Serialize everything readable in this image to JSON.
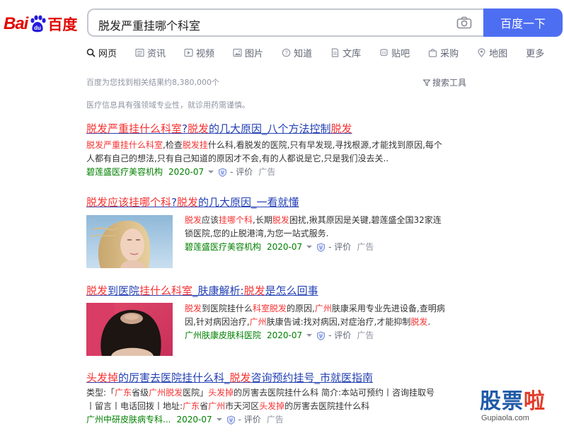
{
  "logo": {
    "left": "Bai",
    "right": "百度"
  },
  "search": {
    "query": "脱发严重挂哪个科室",
    "button": "百度一下"
  },
  "tabs": [
    {
      "label": "网页",
      "icon": "search-icon",
      "active": true
    },
    {
      "label": "资讯",
      "icon": "news-icon"
    },
    {
      "label": "视频",
      "icon": "video-icon"
    },
    {
      "label": "图片",
      "icon": "image-icon"
    },
    {
      "label": "知道",
      "icon": "question-icon"
    },
    {
      "label": "文库",
      "icon": "document-icon"
    },
    {
      "label": "贴吧",
      "icon": "tieba-icon"
    },
    {
      "label": "采购",
      "icon": "purchase-icon"
    },
    {
      "label": "地图",
      "icon": "map-icon"
    },
    {
      "label": "更多",
      "icon": ""
    }
  ],
  "meta": {
    "results_count": "百度为您找到相关结果约8,380,000个",
    "tools": "搜索工具"
  },
  "notice": "医疗信息具有强领域专业性，就诊用药需谨慎。",
  "results": [
    {
      "title_parts": [
        [
          "脱发严重挂什么科室",
          true
        ],
        [
          "?",
          false
        ],
        [
          "脱发",
          true
        ],
        [
          "的几大原因_八个方法控制",
          false
        ],
        [
          "脱发",
          true
        ]
      ],
      "snippet_lines": [
        [
          [
            "脱发严重挂什么科室",
            true
          ],
          [
            ",检查",
            false
          ],
          [
            "脱发挂",
            true
          ],
          [
            "什么科,看脱发的医院,只有早发现,寻找根源,才能找到原因,每个",
            false
          ]
        ],
        [
          [
            "人都有自己的想法,只有自己知道的原因才不会,有的人都说是它,只是我们没去关..",
            false
          ]
        ]
      ],
      "source": "碧莲盛医疗美容机构",
      "date": "2020-07",
      "eval": "- 评价",
      "ad": "广告"
    },
    {
      "title_parts": [
        [
          "脱发应该挂哪个科",
          true
        ],
        [
          "?",
          false
        ],
        [
          "脱发",
          true
        ],
        [
          "的几大原因_一看就懂",
          false
        ]
      ],
      "snippet_lines": [
        [
          [
            "脱发",
            true
          ],
          [
            "应该",
            false
          ],
          [
            "挂哪个科",
            true
          ],
          [
            ",长期",
            false
          ],
          [
            "脱发",
            true
          ],
          [
            "困扰,揪其原因是关键,碧莲盛全国32家连",
            false
          ]
        ],
        [
          [
            "锁医院,您的止脱港湾,为您一站式服务.",
            false
          ]
        ]
      ],
      "source": "碧莲盛医疗美容机构",
      "date": "2020-07",
      "eval": "- 评价",
      "ad": "广告"
    },
    {
      "title_parts": [
        [
          "脱发",
          true
        ],
        [
          "到医院",
          false
        ],
        [
          "挂什么科室",
          true
        ],
        [
          "_肤康解析:",
          false
        ],
        [
          "脱发",
          true
        ],
        [
          "是怎么回事",
          false
        ]
      ],
      "snippet_lines": [
        [
          [
            "脱发",
            true
          ],
          [
            "到医院挂什么",
            false
          ],
          [
            "科室脱发",
            true
          ],
          [
            "的原因,",
            false
          ],
          [
            "广州",
            true
          ],
          [
            "肤康采用专业先进设备,查明病",
            false
          ]
        ],
        [
          [
            "因,针对病因治疗,",
            false
          ],
          [
            "广州",
            true
          ],
          [
            "肤康告诫:找对病因,对症治疗,才能抑制",
            false
          ],
          [
            "脱发",
            true
          ],
          [
            ".",
            false
          ]
        ]
      ],
      "source": "广州肤康皮肤科医院",
      "date": "2020-07",
      "eval": "- 评价",
      "ad": "广告"
    },
    {
      "title_parts": [
        [
          "头发掉",
          true
        ],
        [
          "的厉害去医院挂什么科_",
          false
        ],
        [
          "脱发",
          true
        ],
        [
          "咨询预约挂号_市就医指南",
          false
        ]
      ],
      "snippet_lines": [
        [
          [
            "类型:「",
            false
          ],
          [
            "广东",
            true
          ],
          [
            "省级",
            false
          ],
          [
            "广州脱发",
            true
          ],
          [
            "医院」",
            false
          ],
          [
            "头发掉",
            true
          ],
          [
            "的厉害去医院挂什么科 简介:本站可预约丨咨询挂取号",
            false
          ]
        ],
        [
          [
            "丨留言丨电话回拨丨地址:",
            false
          ],
          [
            "广东",
            true
          ],
          [
            "省",
            false
          ],
          [
            "广州",
            true
          ],
          [
            "市天河区",
            false
          ],
          [
            "头发掉",
            true
          ],
          [
            "的厉害去医院挂什么科",
            false
          ]
        ]
      ],
      "source": "广州中研皮肤病专科...",
      "date": "2020-07",
      "eval": "- 评价",
      "ad": "广告"
    }
  ],
  "watermark": {
    "text1": "股票",
    "text2": "啦",
    "url": "Gupiaola.com"
  },
  "colors": {
    "brand_red": "#e10602",
    "brand_blue": "#4e6ef2",
    "link": "#2440b3",
    "highlight": "#f73131",
    "source_green": "#008000"
  }
}
